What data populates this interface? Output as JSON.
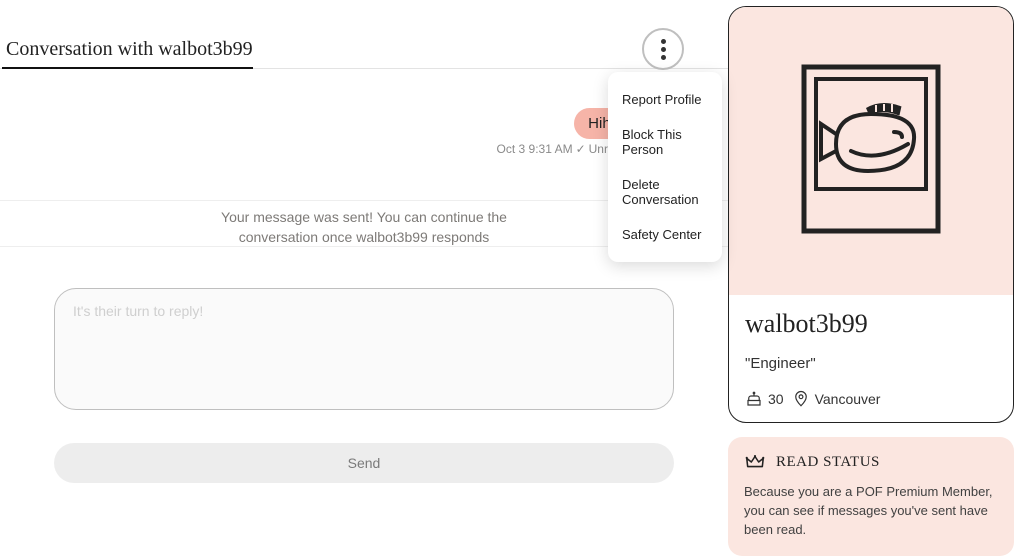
{
  "header": {
    "title": "Conversation with walbot3b99"
  },
  "dropdown": {
    "items": [
      {
        "label": "Report Profile"
      },
      {
        "label": "Block This Person"
      },
      {
        "label": "Delete Conversation"
      },
      {
        "label": "Safety Center"
      }
    ]
  },
  "message": {
    "text": "Hihi",
    "timestamp": "Oct 3 9:31 AM",
    "status": "Unread"
  },
  "info_line1": "Your message was sent! You can continue the",
  "info_line2": "conversation once walbot3b99 responds",
  "compose": {
    "placeholder": "It's their turn to reply!",
    "send_label": "Send"
  },
  "profile": {
    "name": "walbot3b99",
    "tagline": "\"Engineer\"",
    "age": "30",
    "location": "Vancouver"
  },
  "readstatus": {
    "title": "READ STATUS",
    "body": "Because you are a POF Premium Member, you can see if messages you've sent have been read."
  }
}
